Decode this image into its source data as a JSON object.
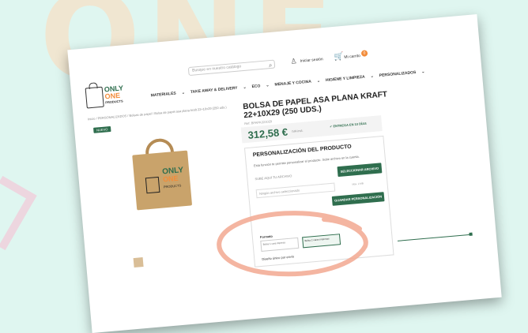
{
  "header": {
    "search_placeholder": "Busque en nuestro catálogo",
    "login": "Iniciar sesión",
    "cart_label": "Mi carrito",
    "cart_count": "0"
  },
  "logo": {
    "line1": "ONLY",
    "line2": "ONE",
    "line3": "PRODUCTS"
  },
  "nav": {
    "items": [
      "MATERIALES",
      "TAKE AWAY & DELIVERY",
      "ECO",
      "MENAJE Y COCINA",
      "HIGIENE Y LIMPIEZA",
      "PERSONALIZADOS"
    ]
  },
  "breadcrumb": "Inicio / PERSONALIZADOS / Bolsas de papel / Bolsa de papel asa plana kraft 22+10x29 (250 uds.)",
  "badge": "NUEVO",
  "product": {
    "title": "BOLSA DE PAPEL ASA PLANA KRAFT 22+10X29 (250 UDS.)",
    "ref": "Ref: BPAPK221029",
    "price": "312,58 €",
    "iva": "IVA incl.",
    "delivery": "✓ ENTREGA EN 10 DÍAS"
  },
  "personalization": {
    "title": "PERSONALIZACIÓN DEL PRODUCTO",
    "description": "Esta función te permite personalizar el producto. Subir archivo en la cuenta.",
    "artwork_label": "SUBE AQUÍ TU ARCHIVO",
    "select_button": "SELECCIONAR ARCHIVO",
    "upload_placeholder": "Ningún archivo seleccionado",
    "size_note": "Máx. 2 MB",
    "save_button": "GUARDAR PERSONALIZACIÓN"
  },
  "format": {
    "label": "Formato",
    "options": [
      "Bolsa 1 cara impresa",
      "Bolsa 2 caras impresas"
    ],
    "per_label": "Diseño único por envío"
  },
  "colors": {
    "brand_green": "#2f6e4e",
    "brand_orange": "#f28c3a",
    "annotation": "#f2a890"
  }
}
